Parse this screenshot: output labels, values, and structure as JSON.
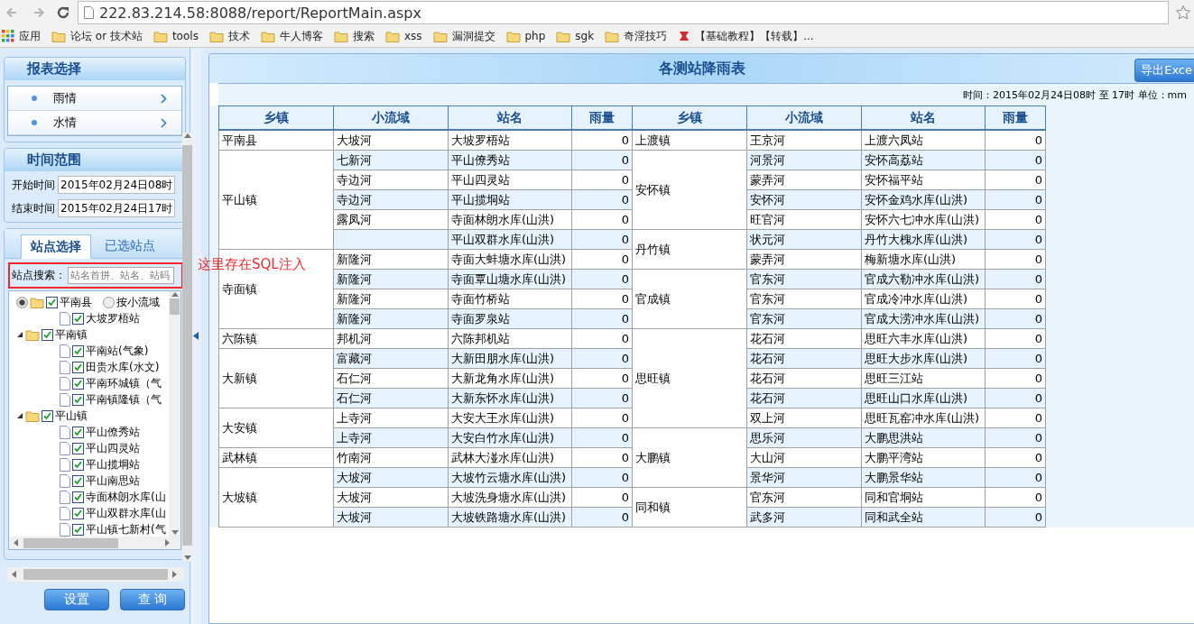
{
  "browser": {
    "url": "222.83.214.58:8088/report/ReportMain.aspx",
    "bookmarks": [
      {
        "label": "应用",
        "kind": "apps"
      },
      {
        "label": "论坛 or 技术站",
        "kind": "folder"
      },
      {
        "label": "tools",
        "kind": "folder"
      },
      {
        "label": "技术",
        "kind": "folder"
      },
      {
        "label": "牛人博客",
        "kind": "folder"
      },
      {
        "label": "搜索",
        "kind": "folder"
      },
      {
        "label": "xss",
        "kind": "folder"
      },
      {
        "label": "漏洞提交",
        "kind": "folder"
      },
      {
        "label": "php",
        "kind": "folder"
      },
      {
        "label": "sgk",
        "kind": "folder"
      },
      {
        "label": "奇淫技巧",
        "kind": "folder"
      },
      {
        "label": "【基础教程】【转载】...",
        "kind": "page"
      }
    ]
  },
  "sidebar": {
    "report_section": {
      "title": "报表选择",
      "items": [
        {
          "label": "雨情"
        },
        {
          "label": "水情"
        }
      ]
    },
    "time_section": {
      "title": "时间范围",
      "fields": [
        {
          "label": "开始时间",
          "value": "2015年02月24日08时"
        },
        {
          "label": "结束时间",
          "value": "2015年02月24日17时"
        }
      ]
    },
    "station_tabs": [
      {
        "label": "站点选择",
        "selected": true
      },
      {
        "label": "已选站点",
        "selected": false
      }
    ],
    "search": {
      "label": "站点搜索：",
      "placeholder": "站名首拼、站名、站码",
      "highlighted": true
    },
    "mode_radios": [
      {
        "selected": true
      },
      {
        "label": "按小流域",
        "selected": false
      }
    ],
    "tree": [
      {
        "label": "平南县",
        "checked": true,
        "children": [
          {
            "label": "大坡罗梧站",
            "checked": true
          }
        ]
      },
      {
        "label": "平南镇",
        "checked": true,
        "expanded": true,
        "children": [
          {
            "label": "平南站(气象)",
            "checked": true
          },
          {
            "label": "田贵水库(水文)",
            "checked": true
          },
          {
            "label": "平南环城镇（气",
            "checked": true
          },
          {
            "label": "平南镇隆镇（气",
            "checked": true
          }
        ]
      },
      {
        "label": "平山镇",
        "checked": true,
        "expanded": true,
        "children": [
          {
            "label": "平山僚秀站",
            "checked": true
          },
          {
            "label": "平山四灵站",
            "checked": true
          },
          {
            "label": "平山揽垌站",
            "checked": true
          },
          {
            "label": "平山南思站",
            "checked": true
          },
          {
            "label": "寺面林朗水库(山",
            "checked": true
          },
          {
            "label": "平山双群水库(山",
            "checked": true
          },
          {
            "label": "平山镇七新村(气",
            "checked": true
          }
        ]
      }
    ],
    "buttons": [
      "设置",
      "查 询"
    ]
  },
  "annotation": {
    "text": "这里存在SQL注入"
  },
  "report": {
    "title": "各测站降雨表",
    "export_button": "导出Exce",
    "info": "时间：2015年02月24日08时 至 17时 单位：mm",
    "columns": [
      "乡镇",
      "小流域",
      "站名",
      "雨量",
      "乡镇",
      "小流域",
      "站名",
      "雨量"
    ],
    "left_groups": [
      {
        "town": "平南县",
        "stations": [
          {
            "basin": "大坡河",
            "station": "大坡罗梧站",
            "rain": "0"
          }
        ]
      },
      {
        "town": "平山镇",
        "stations": [
          {
            "basin": "七新河",
            "station": "平山僚秀站",
            "rain": "0"
          },
          {
            "basin": "寺边河",
            "station": "平山四灵站",
            "rain": "0"
          },
          {
            "basin": "寺边河",
            "station": "平山揽垌站",
            "rain": "0"
          },
          {
            "basin": "露凤河",
            "station": "寺面林朗水库(山洪)",
            "rain": "0"
          },
          {
            "station": "平山双群水库(山洪)",
            "rain": "0"
          }
        ]
      },
      {
        "town": "寺面镇",
        "stations": [
          {
            "basin": "新隆河",
            "station": "寺面大蚌塘水库(山洪)",
            "rain": "0"
          },
          {
            "basin": "新隆河",
            "station": "寺面覃山塘水库(山洪)",
            "rain": "0"
          },
          {
            "basin": "新隆河",
            "station": "寺面竹桥站",
            "rain": "0"
          },
          {
            "basin": "新隆河",
            "station": "寺面罗泉站",
            "rain": "0"
          }
        ]
      },
      {
        "town": "六陈镇",
        "stations": [
          {
            "basin": "邦机河",
            "station": "六陈邦机站",
            "rain": "0"
          }
        ]
      },
      {
        "town": "大新镇",
        "stations": [
          {
            "basin": "富藏河",
            "station": "大新田朋水库(山洪)",
            "rain": "0"
          },
          {
            "basin": "石仁河",
            "station": "大新龙角水库(山洪)",
            "rain": "0"
          },
          {
            "basin": "石仁河",
            "station": "大新东怀水库(山洪)",
            "rain": "0"
          }
        ]
      },
      {
        "town": "大安镇",
        "stations": [
          {
            "basin": "上寺河",
            "station": "大安大王水库(山洪)",
            "rain": "0"
          },
          {
            "basin": "上寺河",
            "station": "大安白竹水库(山洪)",
            "rain": "0"
          }
        ]
      },
      {
        "town": "武林镇",
        "stations": [
          {
            "basin": "竹南河",
            "station": "武林大湴水库(山洪)",
            "rain": "0"
          }
        ]
      },
      {
        "town": "大坡镇",
        "stations": [
          {
            "basin": "大坡河",
            "station": "大坡竹云塘水库(山洪)",
            "rain": "0"
          },
          {
            "basin": "大坡河",
            "station": "大坡洗身塘水库(山洪)",
            "rain": "0"
          },
          {
            "basin": "大坡河",
            "station": "大坡铁路塘水库(山洪)",
            "rain": "0"
          }
        ]
      }
    ],
    "right_groups": [
      {
        "town": "上渡镇",
        "stations": [
          {
            "basin": "王京河",
            "station": "上渡六凤站",
            "rain": "0"
          }
        ]
      },
      {
        "town": "安怀镇",
        "stations": [
          {
            "basin": "河景河",
            "station": "安怀高荔站",
            "rain": "0"
          },
          {
            "basin": "蒙弄河",
            "station": "安怀福平站",
            "rain": "0"
          },
          {
            "basin": "安怀河",
            "station": "安怀金鸡水库(山洪)",
            "rain": "0"
          },
          {
            "basin": "旺官河",
            "station": "安怀六七冲水库(山洪)",
            "rain": "0"
          }
        ]
      },
      {
        "town": "丹竹镇",
        "stations": [
          {
            "basin": "状元河",
            "station": "丹竹大槐水库(山洪)",
            "rain": "0"
          },
          {
            "basin": "蒙弄河",
            "station": "梅新塘水库(山洪)",
            "rain": "0"
          }
        ]
      },
      {
        "town": "官成镇",
        "stations": [
          {
            "basin": "官东河",
            "station": "官成六勒冲水库(山洪)",
            "rain": "0"
          },
          {
            "basin": "官东河",
            "station": "官成冷冲水库(山洪)",
            "rain": "0"
          },
          {
            "basin": "官东河",
            "station": "官成大涝冲水库(山洪)",
            "rain": "0"
          }
        ]
      },
      {
        "town": "思旺镇",
        "stations": [
          {
            "basin": "花石河",
            "station": "思旺六丰水库(山洪)",
            "rain": "0"
          },
          {
            "basin": "花石河",
            "station": "思旺大步水库(山洪)",
            "rain": "0"
          },
          {
            "basin": "花石河",
            "station": "思旺三江站",
            "rain": "0"
          },
          {
            "basin": "花石河",
            "station": "思旺山口水库(山洪)",
            "rain": "0"
          },
          {
            "basin": "双上河",
            "station": "思旺瓦窑冲水库(山洪)",
            "rain": "0"
          }
        ]
      },
      {
        "town": "大鹏镇",
        "stations": [
          {
            "basin": "思乐河",
            "station": "大鹏思洪站",
            "rain": "0"
          },
          {
            "basin": "大山河",
            "station": "大鹏平湾站",
            "rain": "0"
          },
          {
            "basin": "景华河",
            "station": "大鹏景华站",
            "rain": "0"
          }
        ]
      },
      {
        "town": "同和镇",
        "stations": [
          {
            "basin": "官东河",
            "station": "同和官垌站",
            "rain": "0"
          },
          {
            "basin": "武多河",
            "station": "同和武全站",
            "rain": "0"
          }
        ]
      }
    ]
  }
}
